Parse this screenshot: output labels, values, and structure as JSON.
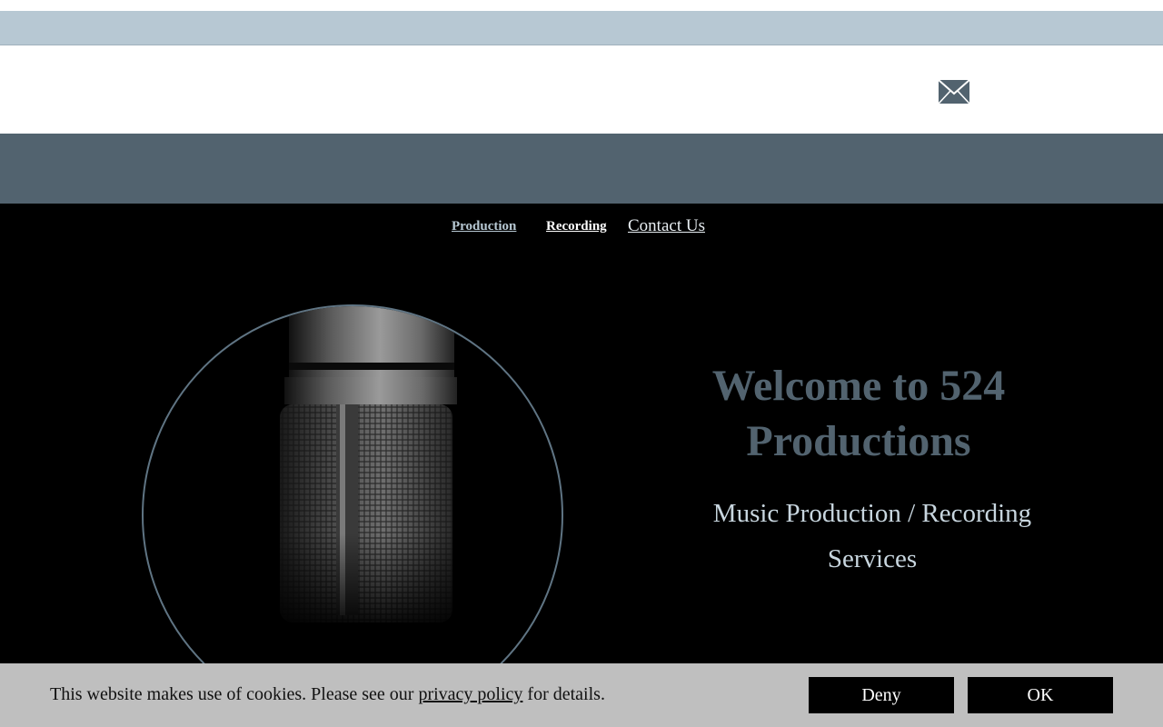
{
  "nav": {
    "production": "Production",
    "recording": "Recording",
    "contact": "Contact Us"
  },
  "hero": {
    "title": "Welcome to 524 Productions",
    "subtitle": "Music Production  / Recording Services"
  },
  "header": {
    "icon": "envelope-icon"
  },
  "cookie": {
    "text_before": "This website makes use of cookies. Please see our ",
    "link": "privacy policy",
    "text_after": " for details.",
    "deny": "Deny",
    "ok": "OK"
  },
  "colors": {
    "top_strip": "#b7c8d3",
    "slate_band": "#52636f",
    "hero_bg": "#000000",
    "title": "#52636f",
    "subtitle": "#c8d6df",
    "cookie_bg": "#bfbfbf"
  }
}
